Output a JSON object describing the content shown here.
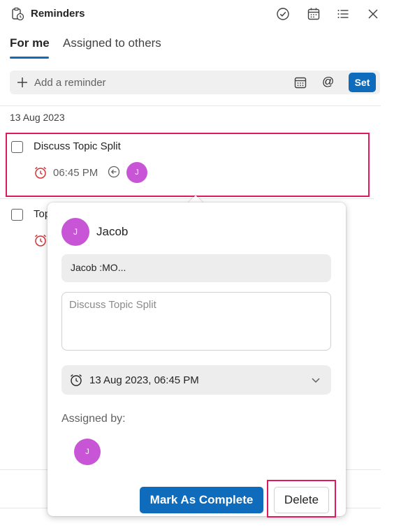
{
  "header": {
    "title": "Reminders",
    "icons": [
      "clipboard-clock-icon",
      "check-circle-icon",
      "calendar-icon",
      "list-icon",
      "close-icon"
    ]
  },
  "tabs": [
    {
      "label": "For me",
      "active": true
    },
    {
      "label": "Assigned to others",
      "active": false
    }
  ],
  "add_bar": {
    "placeholder": "Add a reminder",
    "set_label": "Set",
    "icons": [
      "plus-icon",
      "calendar-icon",
      "mention-icon"
    ]
  },
  "group_date": "13 Aug 2023",
  "reminders": [
    {
      "title": "Discuss Topic Split",
      "time": "06:45 PM",
      "avatar_initial": "J"
    },
    {
      "title": "Top"
    }
  ],
  "popup": {
    "avatar_initial": "J",
    "name": "Jacob",
    "message": "Jacob :MO...",
    "description_placeholder": "Discuss Topic Split",
    "date_value": "13 Aug 2023, 06:45 PM",
    "assigned_label": "Assigned by:",
    "assigned_avatar_initial": "J",
    "complete_label": "Mark As Complete",
    "delete_label": "Delete"
  },
  "colors": {
    "accent": "#0f6cbd",
    "highlight": "#e0195f",
    "avatar": "#c855d6",
    "alarm": "#d13438"
  }
}
